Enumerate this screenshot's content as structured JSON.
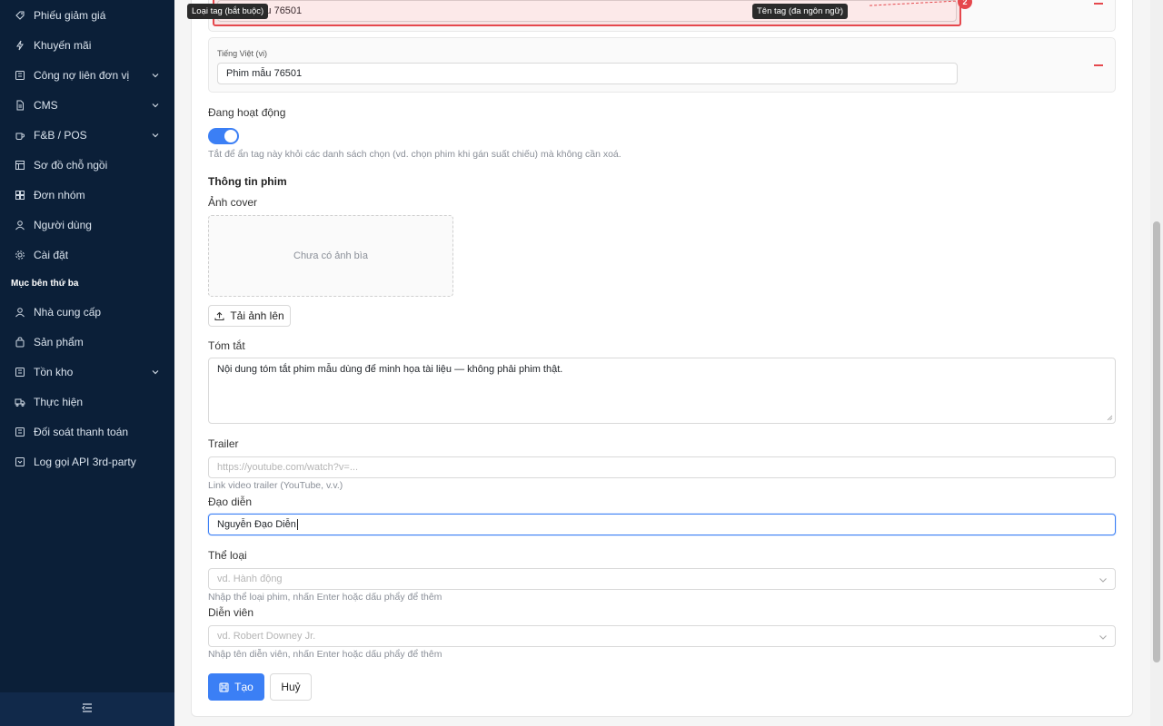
{
  "sidebar": {
    "items": [
      {
        "label": "Phiếu giảm giá",
        "icon": "tag-icon",
        "has_chevron": false
      },
      {
        "label": "Khuyến mãi",
        "icon": "bolt-icon",
        "has_chevron": false
      },
      {
        "label": "Công nợ liên đơn vị",
        "icon": "ledger-icon",
        "has_chevron": true
      },
      {
        "label": "CMS",
        "icon": "document-icon",
        "has_chevron": true
      },
      {
        "label": "F&B / POS",
        "icon": "cup-icon",
        "has_chevron": true
      },
      {
        "label": "Sơ đồ chỗ ngồi",
        "icon": "layout-icon",
        "has_chevron": false
      },
      {
        "label": "Đơn nhóm",
        "icon": "grid-icon",
        "has_chevron": false
      },
      {
        "label": "Người dùng",
        "icon": "user-icon",
        "has_chevron": false
      },
      {
        "label": "Cài đặt",
        "icon": "gear-icon",
        "has_chevron": false
      }
    ],
    "section_title": "Mục bên thứ ba",
    "third_party_items": [
      {
        "label": "Nhà cung cấp",
        "icon": "user-icon",
        "has_chevron": false
      },
      {
        "label": "Sản phẩm",
        "icon": "bag-icon",
        "has_chevron": false
      },
      {
        "label": "Tồn kho",
        "icon": "ledger-icon",
        "has_chevron": true
      },
      {
        "label": "Thực hiện",
        "icon": "truck-icon",
        "has_chevron": false
      },
      {
        "label": "Đối soát thanh toán",
        "icon": "ledger-icon",
        "has_chevron": false
      },
      {
        "label": "Log gọi API 3rd-party",
        "icon": "log-icon",
        "has_chevron": false
      }
    ],
    "footer_icon": "menu-collapse-icon"
  },
  "form": {
    "top_lang_value": "Phim mẫu 76501",
    "vi_lang_label": "Tiếng Việt (vi)",
    "vi_lang_value": "Phim mẫu 76501",
    "active_label": "Đang hoạt động",
    "active_on": true,
    "active_help": "Tắt để ẩn tag này khỏi các danh sách chọn (vd. chọn phim khi gán suất chiếu) mà không cần xoá.",
    "section_title": "Thông tin phim",
    "cover_label": "Ảnh cover",
    "cover_empty": "Chưa có ảnh bìa",
    "upload_label": "Tải ảnh lên",
    "summary_label": "Tóm tắt",
    "summary_value": "Nội dung tóm tắt phim mẫu dùng để minh họa tài liệu — không phải phim thật.",
    "trailer_label": "Trailer",
    "trailer_placeholder": "https://youtube.com/watch?v=...",
    "trailer_help": "Link video trailer (YouTube, v.v.)",
    "director_label": "Đạo diễn",
    "director_value": "Nguyễn Đạo Diễn",
    "genre_label": "Thể loại",
    "genre_placeholder": "vd. Hành động",
    "genre_help": "Nhập thể loại phim, nhấn Enter hoặc dấu phẩy để thêm",
    "cast_label": "Diễn viên",
    "cast_placeholder": "vd. Robert Downey Jr.",
    "cast_help": "Nhập tên diễn viên, nhấn Enter hoặc dấu phẩy để thêm",
    "create_label": "Tạo",
    "cancel_label": "Huỷ"
  },
  "annotations": {
    "tooltip_left": "Loại tag (bắt buộc)",
    "tooltip_right": "Tên tag (đa ngôn ngữ)",
    "badge_number": "2"
  },
  "colors": {
    "sidebar_bg": "#0b1f38",
    "primary": "#3b7ff5",
    "error": "#e5484d"
  }
}
